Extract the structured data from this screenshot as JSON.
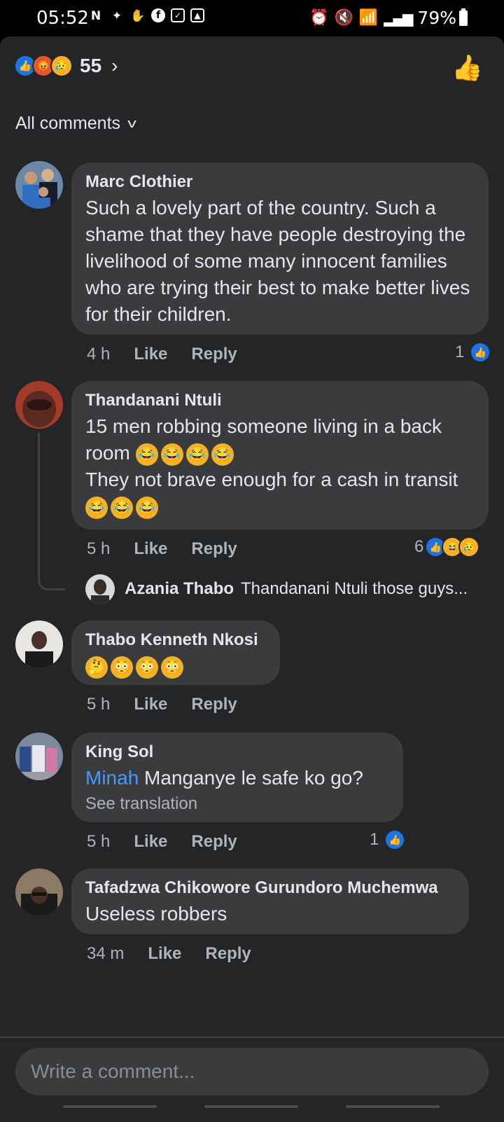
{
  "status": {
    "time": "05:52",
    "battery": "79%"
  },
  "header": {
    "reaction_count": "55",
    "sort_label": "All comments"
  },
  "comments": [
    {
      "name": "Marc Clothier",
      "text": "Such a lovely part of the country.  Such a shame that they have people destroying the livelihood of some many innocent families who are trying their best to make better lives for their children.",
      "time": "4 h",
      "like": "Like",
      "reply": "Reply",
      "reactions": "1"
    },
    {
      "name": "Thandanani Ntuli",
      "text_line1": "15 men robbing someone living in a back room",
      "text_line2": "They not brave enough for a cash in transit",
      "time": "5 h",
      "like": "Like",
      "reply": "Reply",
      "reactions": "6"
    },
    {
      "name": "Thabo Kenneth Nkosi",
      "time": "5 h",
      "like": "Like",
      "reply": "Reply"
    },
    {
      "name": "King Sol",
      "mention": "Minah",
      "text": "Manganye le safe ko go?",
      "see_translation": "See translation",
      "time": "5 h",
      "like": "Like",
      "reply": "Reply",
      "reactions": "1"
    },
    {
      "name": "Tafadzwa Chikowore Gurundoro Muchemwa",
      "text": "Useless robbers",
      "time": "34 m",
      "like": "Like",
      "reply": "Reply"
    }
  ],
  "reply_preview": {
    "name": "Azania Thabo",
    "text": "Thandanani Ntuli those guys..."
  },
  "composer": {
    "placeholder": "Write a comment..."
  }
}
